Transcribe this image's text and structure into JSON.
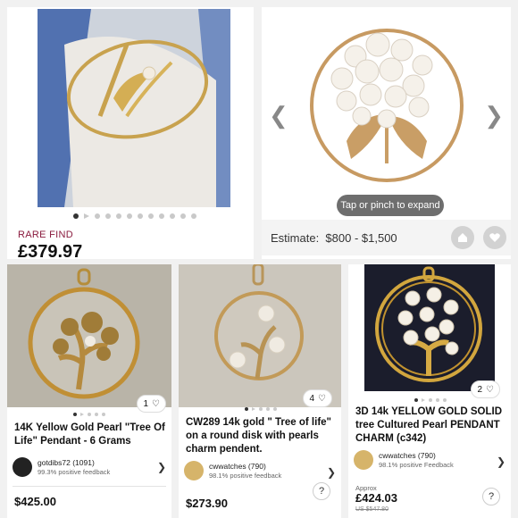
{
  "listing_main": {
    "badge": "RARE FIND",
    "price": "£379.97",
    "photo_count": 12,
    "active_photo": 0
  },
  "listing_estimate": {
    "tap_hint": "Tap or pinch to expand",
    "estimate_label": "Estimate:",
    "estimate_value": "$800 - $1,500"
  },
  "cards": [
    {
      "likes": "1",
      "title": "14K Yellow Gold Pearl \"Tree Of Life\" Pendant - 6 Grams",
      "seller_name": "gotdibs72 (1091)",
      "seller_feedback": "99.3% positive feedback",
      "price": "$425.00",
      "photo_count": 5
    },
    {
      "likes": "4",
      "title": "CW289 14k gold \" Tree of life\" on a round disk with pearls charm pendent.",
      "seller_name": "cwwatches (790)",
      "seller_feedback": "98.1% positive feedback",
      "price": "$273.90",
      "photo_count": 5
    },
    {
      "likes": "2",
      "title": "3D 14k YELLOW GOLD SOLID tree Cultured Pearl PENDANT CHARM (c342)",
      "seller_name": "cwwatches (790)",
      "seller_feedback": "98.1% positive Feedback",
      "approx_label": "Approx",
      "price": "£424.03",
      "was_price": "US $547.80",
      "photo_count": 5
    }
  ],
  "colors": {
    "badge_red": "#8a1b3e",
    "gold": "#c9a24a",
    "pearl": "#f4efe6"
  }
}
